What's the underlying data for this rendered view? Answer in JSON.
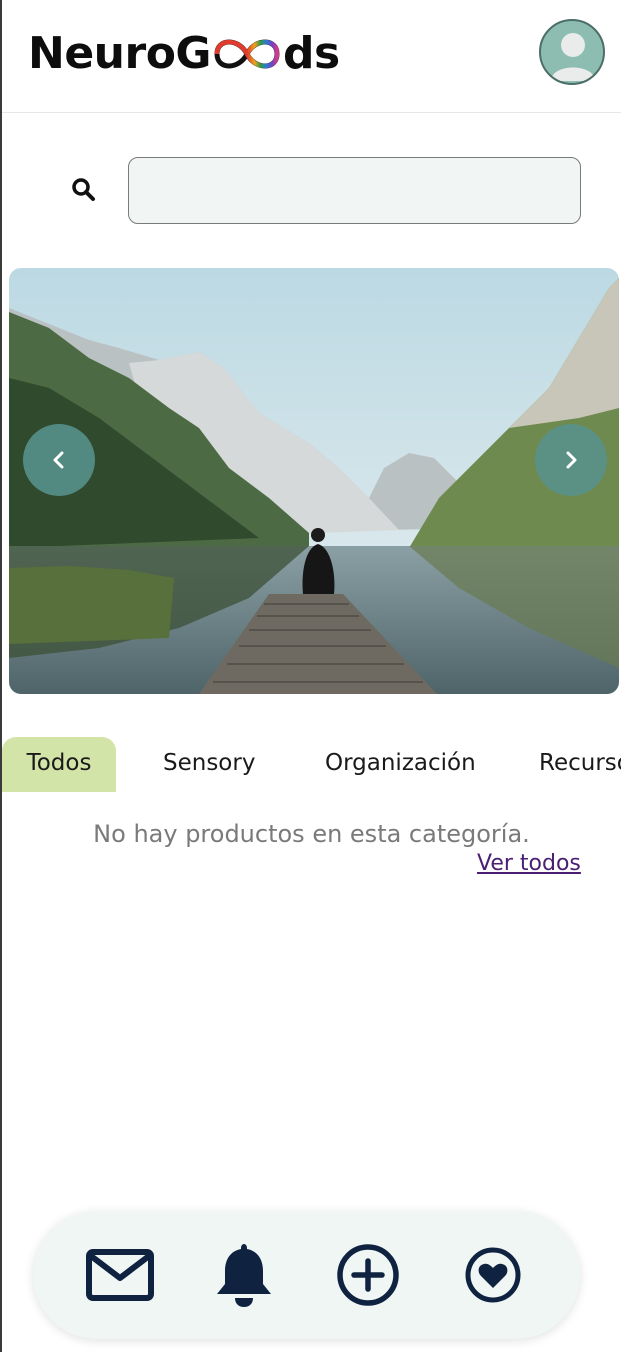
{
  "header": {
    "logo_left": "NeuroG",
    "logo_right": "ds",
    "avatar_icon": "user-avatar-icon"
  },
  "search": {
    "icon": "search-icon",
    "placeholder": "",
    "value": ""
  },
  "carousel": {
    "image": "mountain-lake-person-on-pier",
    "prev_icon": "chevron-left-icon",
    "next_icon": "chevron-right-icon"
  },
  "tabs": {
    "items": [
      {
        "label": "Todos",
        "active": true
      },
      {
        "label": "Sensory",
        "active": false
      },
      {
        "label": "Organización",
        "active": false
      },
      {
        "label": "Recursos",
        "active": false
      }
    ]
  },
  "empty_state": {
    "message": "No hay productos en esta categoría.",
    "link": "Ver todos"
  },
  "bottom_nav": {
    "items": [
      {
        "icon": "envelope-icon"
      },
      {
        "icon": "bell-icon"
      },
      {
        "icon": "plus-circle-icon"
      },
      {
        "icon": "heart-circle-icon"
      }
    ]
  },
  "colors": {
    "accent_teal": "#58928c",
    "tab_active": "#d3e4a9",
    "nav_icon": "#0f2340",
    "link": "#4a1e73"
  }
}
